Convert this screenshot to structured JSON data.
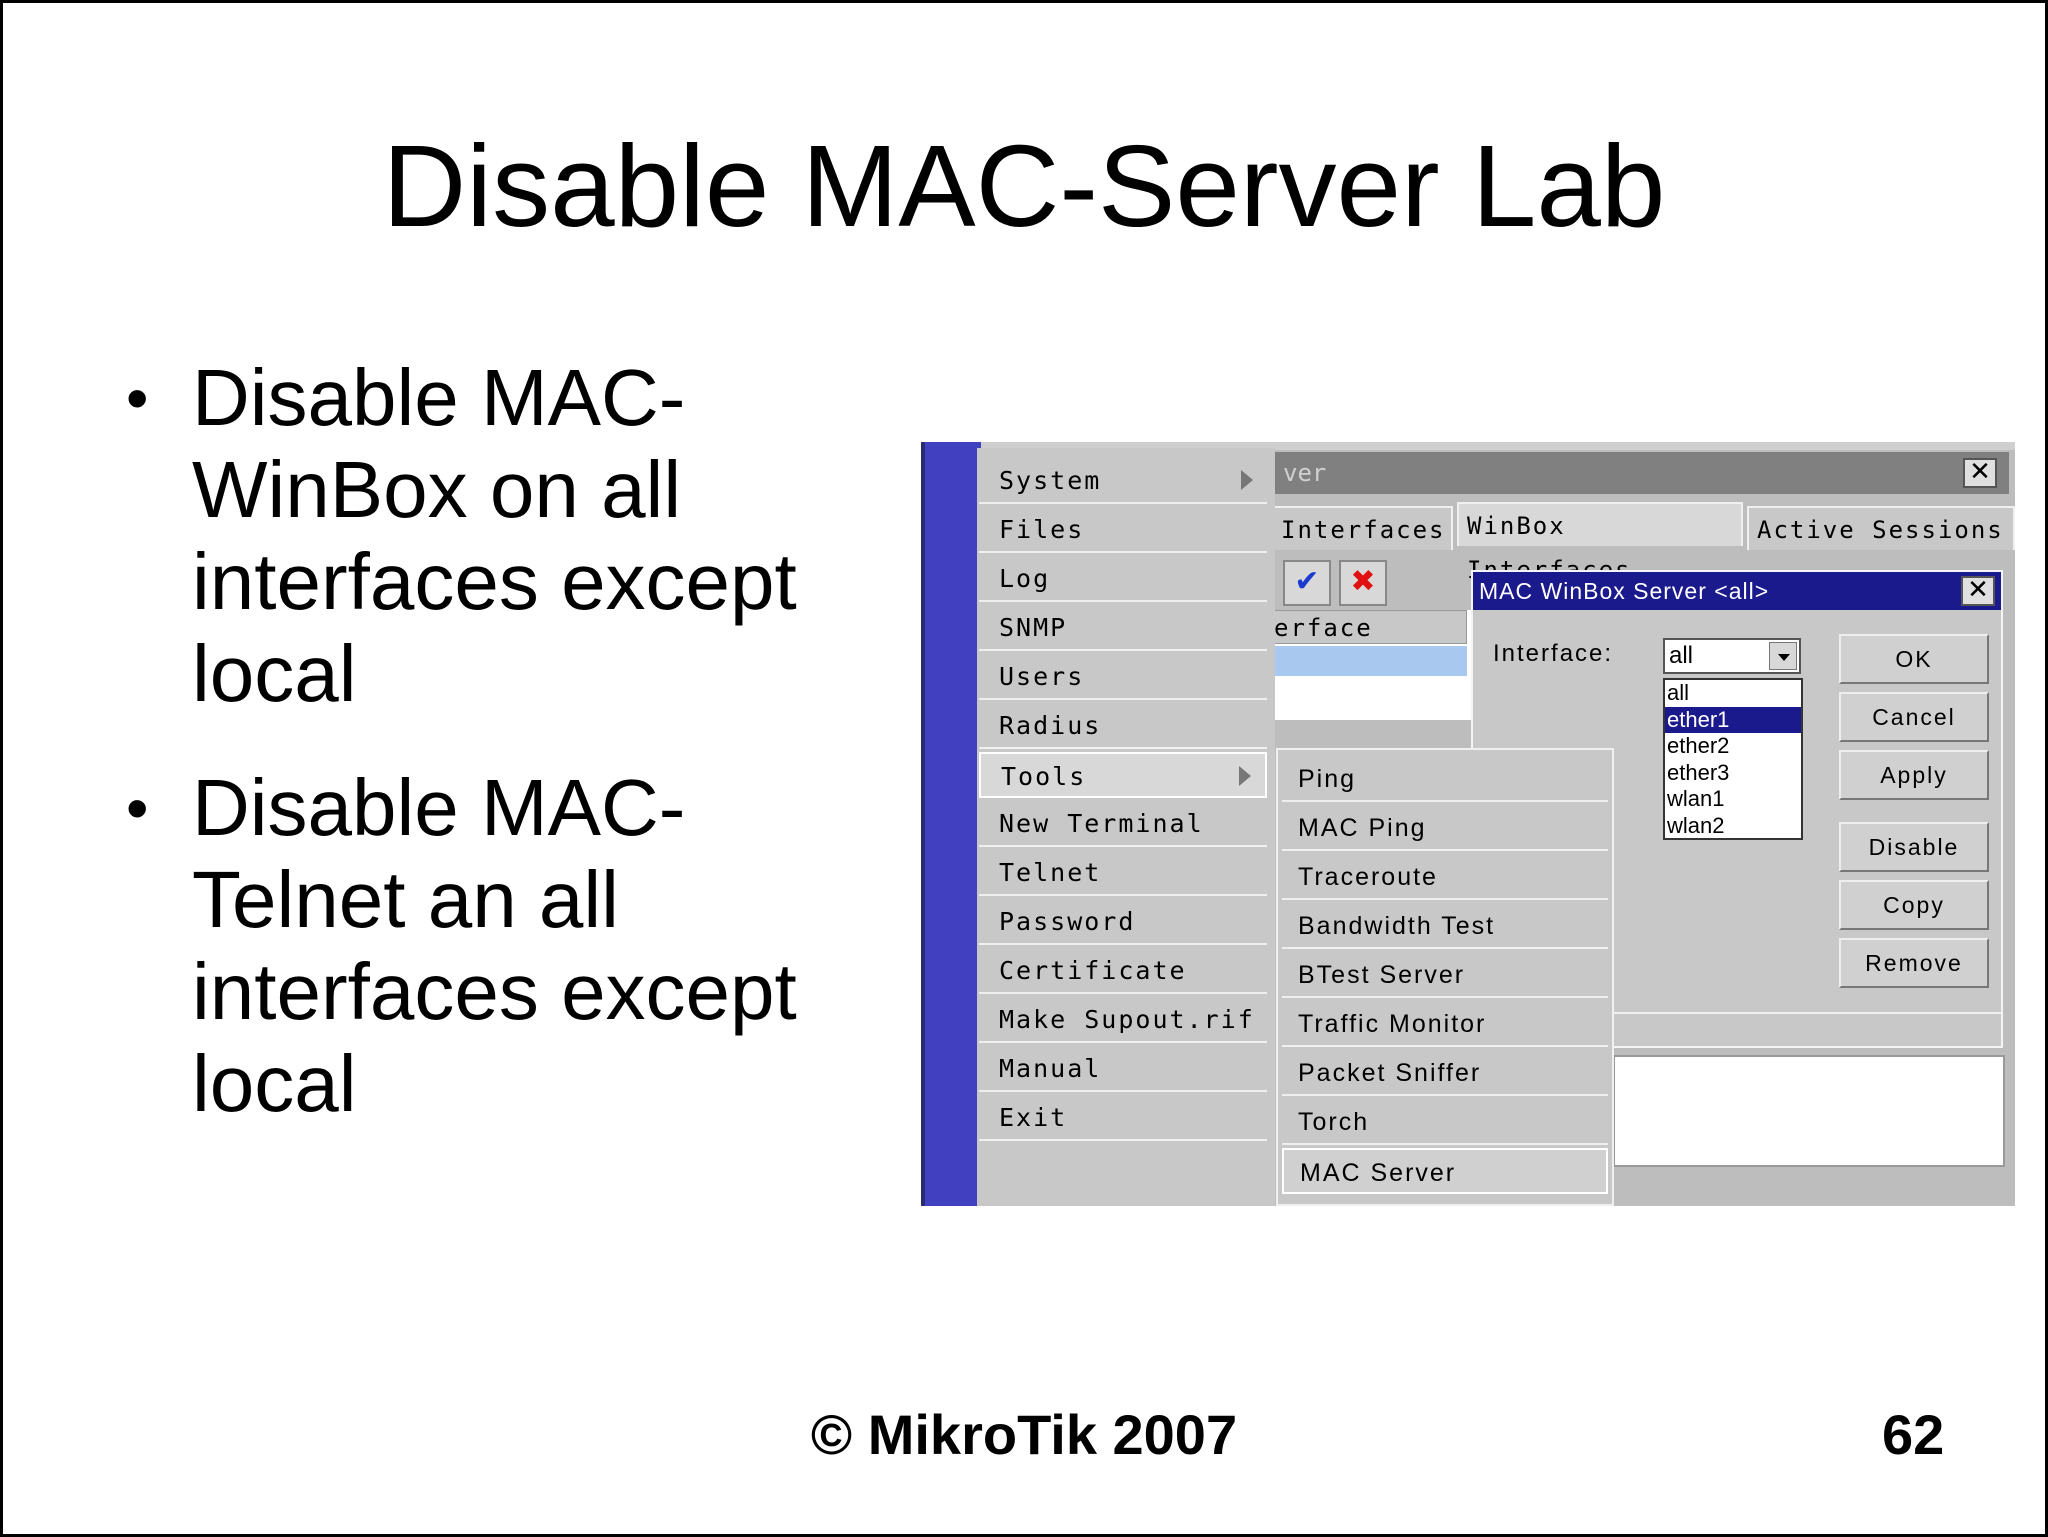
{
  "slide": {
    "title": "Disable MAC-Server Lab",
    "bullets": [
      "Disable MAC-WinBox on all interfaces except local",
      "Disable MAC-Telnet an all interfaces except local"
    ],
    "footer": "© MikroTik 2007",
    "page_number": "62"
  },
  "screenshot": {
    "main_menu": [
      "System",
      "Files",
      "Log",
      "SNMP",
      "Users",
      "Radius",
      "Tools",
      "New Terminal",
      "Telnet",
      "Password",
      "Certificate",
      "Make Supout.rif",
      "Manual",
      "Exit"
    ],
    "main_menu_selected": "Tools",
    "tools_submenu": [
      "Ping",
      "MAC Ping",
      "Traceroute",
      "Bandwidth Test",
      "BTest Server",
      "Traffic Monitor",
      "Packet Sniffer",
      "Torch",
      "MAC Server"
    ],
    "tools_submenu_selected": "MAC Server",
    "background_window": {
      "title_fragment": "ver",
      "tabs": [
        "Interfaces",
        "WinBox Interfaces",
        "Active Sessions"
      ],
      "active_tab": "WinBox Interfaces",
      "column_header": "erface"
    },
    "dialog": {
      "title": "MAC WinBox Server <all>",
      "interface_label": "Interface:",
      "interface_value": "all",
      "options": [
        "all",
        "ether1",
        "ether2",
        "ether3",
        "wlan1",
        "wlan2"
      ],
      "highlighted_option": "ether1",
      "buttons": {
        "ok": "OK",
        "cancel": "Cancel",
        "apply": "Apply",
        "disable": "Disable",
        "copy": "Copy",
        "remove": "Remove"
      }
    },
    "icons": {
      "enable": "checkmark-icon",
      "disable": "x-icon"
    },
    "colors": {
      "dialog_title": "#1a1a8c",
      "strip": "#4040c0",
      "selection": "#a8c8f0",
      "enable_check": "#1a3ad0",
      "disable_x": "#e01010"
    }
  }
}
